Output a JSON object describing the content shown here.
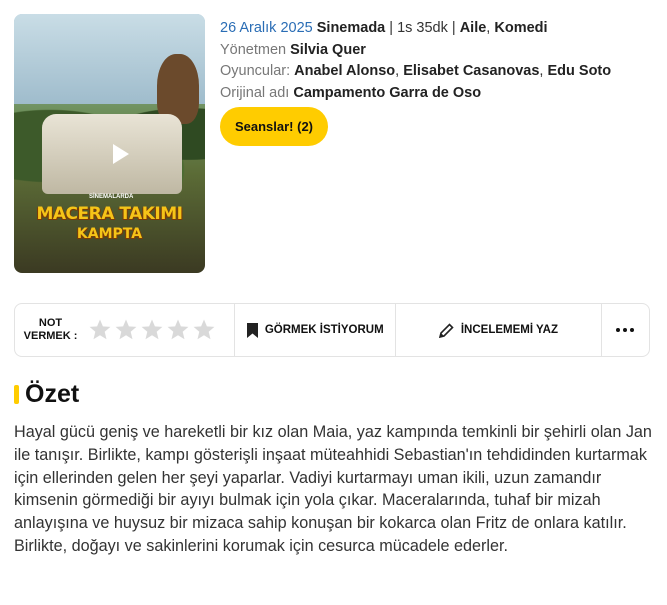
{
  "poster": {
    "title_line1": "MACERA TAKIMI",
    "title_line2": "KAMPTA",
    "stamp": "SİNEMALARDA"
  },
  "info": {
    "date": "26 Aralık 2025",
    "release_status": "Sinemada",
    "sep1": " | ",
    "duration": "1s 35dk",
    "sep2": " | ",
    "genre1": "Aile",
    "genre_sep": ", ",
    "genre2": "Komedi",
    "director_label": "Yönetmen",
    "director": "Silvia Quer",
    "cast_label": "Oyuncular:",
    "cast1": "Anabel Alonso",
    "cast2": "Elisabet Casanovas",
    "cast3": "Edu Soto",
    "cast_sep": ", ",
    "original_label": "Orijinal adı",
    "original_title": "Campamento Garra de Oso"
  },
  "sessions_button": "Seanslar! (2)",
  "actionbar": {
    "rate_label_line1": "NOT",
    "rate_label_line2": "VERMEK :",
    "stars_total": 5,
    "stars_selected": 0,
    "star_color": "#d9d9d9",
    "want_label": "GÖRMEK İSTİYORUM",
    "review_label": "İNCELEMEMİ YAZ",
    "more_icon": "more-horizontal-icon"
  },
  "summary": {
    "title": "Özet",
    "accent": "#ffcc00",
    "text": "Hayal gücü geniş ve hareketli bir kız olan Maia, yaz kampında temkinli bir şehirli olan Jan ile tanışır. Birlikte, kampı gösterişli inşaat müteahhidi Sebastian'ın tehdidinden kurtarmak için ellerinden gelen her şeyi yaparlar. Vadiyi kurtarmayı uman ikili, uzun zamandır kimsenin görmediği bir ayıyı bulmak için yola çıkar. Maceralarında, tuhaf bir mizah anlayışına ve huysuz bir mizaca sahip konuşan bir kokarca olan Fritz de onlara katılır. Birlikte, doğayı ve sakinlerini korumak için cesurca mücadele ederler."
  }
}
